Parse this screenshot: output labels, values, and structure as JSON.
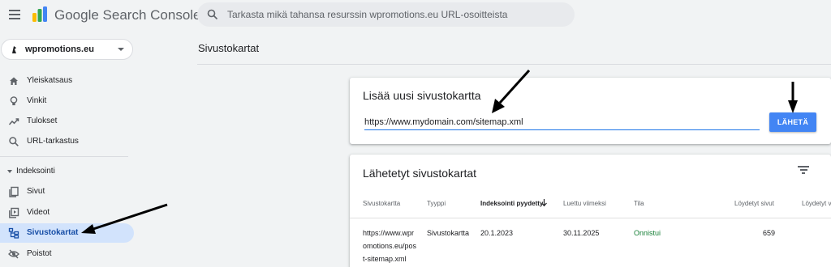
{
  "header": {
    "app_title": "Google Search Console",
    "search_placeholder": "Tarkasta mikä tahansa resurssin wpromotions.eu URL-osoitteista"
  },
  "sidebar": {
    "property": "wpromotions.eu",
    "items": [
      {
        "label": "Yleiskatsaus",
        "icon": "home-icon"
      },
      {
        "label": "Vinkit",
        "icon": "lightbulb-icon"
      },
      {
        "label": "Tulokset",
        "icon": "trending-icon"
      },
      {
        "label": "URL-tarkastus",
        "icon": "search-icon"
      }
    ],
    "section": "Indeksointi",
    "section_items": [
      {
        "label": "Sivut",
        "icon": "pages-icon"
      },
      {
        "label": "Videot",
        "icon": "video-icon"
      },
      {
        "label": "Sivustokartat",
        "icon": "sitemap-icon",
        "active": true
      },
      {
        "label": "Poistot",
        "icon": "visibility-off-icon"
      }
    ]
  },
  "main": {
    "page_title": "Sivustokartat",
    "add_card": {
      "title": "Lisää uusi sivustokartta",
      "input_value": "https://www.mydomain.com/sitemap.xml",
      "submit_label": "LÄHETÄ"
    },
    "submitted_card": {
      "title": "Lähetetyt sivustokartat",
      "columns": [
        "Sivustokartta",
        "Tyyppi",
        "Indeksointi pyydetty",
        "Luettu viimeksi",
        "Tila",
        "Löydetyt sivut",
        "Löydetyt v"
      ],
      "sorted_column": "Indeksointi pyydetty",
      "rows": [
        {
          "sitemap": [
            "https://www.wpr",
            "omotions.eu/pos",
            "t-sitemap.xml"
          ],
          "type": "Sivustokartta",
          "submitted": "20.1.2023",
          "last_read": "30.11.2025",
          "status": "Onnistui",
          "discovered_pages": "659"
        }
      ]
    }
  },
  "colors": {
    "accent": "#4285f4",
    "active_nav": "#d2e3fc",
    "success": "#188038"
  }
}
